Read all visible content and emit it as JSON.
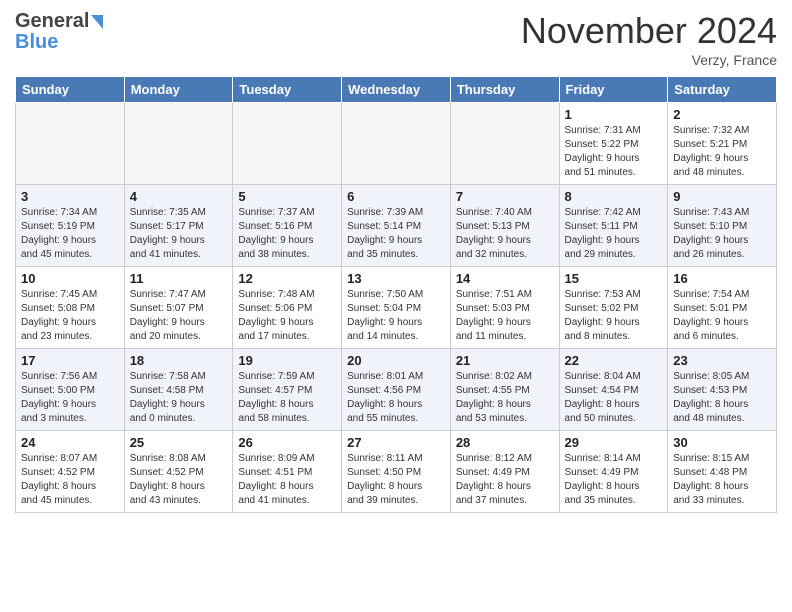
{
  "header": {
    "logo_general": "General",
    "logo_blue": "Blue",
    "title": "November 2024",
    "location": "Verzy, France"
  },
  "columns": [
    "Sunday",
    "Monday",
    "Tuesday",
    "Wednesday",
    "Thursday",
    "Friday",
    "Saturday"
  ],
  "weeks": [
    [
      {
        "day": "",
        "info": ""
      },
      {
        "day": "",
        "info": ""
      },
      {
        "day": "",
        "info": ""
      },
      {
        "day": "",
        "info": ""
      },
      {
        "day": "",
        "info": ""
      },
      {
        "day": "1",
        "info": "Sunrise: 7:31 AM\nSunset: 5:22 PM\nDaylight: 9 hours\nand 51 minutes."
      },
      {
        "day": "2",
        "info": "Sunrise: 7:32 AM\nSunset: 5:21 PM\nDaylight: 9 hours\nand 48 minutes."
      }
    ],
    [
      {
        "day": "3",
        "info": "Sunrise: 7:34 AM\nSunset: 5:19 PM\nDaylight: 9 hours\nand 45 minutes."
      },
      {
        "day": "4",
        "info": "Sunrise: 7:35 AM\nSunset: 5:17 PM\nDaylight: 9 hours\nand 41 minutes."
      },
      {
        "day": "5",
        "info": "Sunrise: 7:37 AM\nSunset: 5:16 PM\nDaylight: 9 hours\nand 38 minutes."
      },
      {
        "day": "6",
        "info": "Sunrise: 7:39 AM\nSunset: 5:14 PM\nDaylight: 9 hours\nand 35 minutes."
      },
      {
        "day": "7",
        "info": "Sunrise: 7:40 AM\nSunset: 5:13 PM\nDaylight: 9 hours\nand 32 minutes."
      },
      {
        "day": "8",
        "info": "Sunrise: 7:42 AM\nSunset: 5:11 PM\nDaylight: 9 hours\nand 29 minutes."
      },
      {
        "day": "9",
        "info": "Sunrise: 7:43 AM\nSunset: 5:10 PM\nDaylight: 9 hours\nand 26 minutes."
      }
    ],
    [
      {
        "day": "10",
        "info": "Sunrise: 7:45 AM\nSunset: 5:08 PM\nDaylight: 9 hours\nand 23 minutes."
      },
      {
        "day": "11",
        "info": "Sunrise: 7:47 AM\nSunset: 5:07 PM\nDaylight: 9 hours\nand 20 minutes."
      },
      {
        "day": "12",
        "info": "Sunrise: 7:48 AM\nSunset: 5:06 PM\nDaylight: 9 hours\nand 17 minutes."
      },
      {
        "day": "13",
        "info": "Sunrise: 7:50 AM\nSunset: 5:04 PM\nDaylight: 9 hours\nand 14 minutes."
      },
      {
        "day": "14",
        "info": "Sunrise: 7:51 AM\nSunset: 5:03 PM\nDaylight: 9 hours\nand 11 minutes."
      },
      {
        "day": "15",
        "info": "Sunrise: 7:53 AM\nSunset: 5:02 PM\nDaylight: 9 hours\nand 8 minutes."
      },
      {
        "day": "16",
        "info": "Sunrise: 7:54 AM\nSunset: 5:01 PM\nDaylight: 9 hours\nand 6 minutes."
      }
    ],
    [
      {
        "day": "17",
        "info": "Sunrise: 7:56 AM\nSunset: 5:00 PM\nDaylight: 9 hours\nand 3 minutes."
      },
      {
        "day": "18",
        "info": "Sunrise: 7:58 AM\nSunset: 4:58 PM\nDaylight: 9 hours\nand 0 minutes."
      },
      {
        "day": "19",
        "info": "Sunrise: 7:59 AM\nSunset: 4:57 PM\nDaylight: 8 hours\nand 58 minutes."
      },
      {
        "day": "20",
        "info": "Sunrise: 8:01 AM\nSunset: 4:56 PM\nDaylight: 8 hours\nand 55 minutes."
      },
      {
        "day": "21",
        "info": "Sunrise: 8:02 AM\nSunset: 4:55 PM\nDaylight: 8 hours\nand 53 minutes."
      },
      {
        "day": "22",
        "info": "Sunrise: 8:04 AM\nSunset: 4:54 PM\nDaylight: 8 hours\nand 50 minutes."
      },
      {
        "day": "23",
        "info": "Sunrise: 8:05 AM\nSunset: 4:53 PM\nDaylight: 8 hours\nand 48 minutes."
      }
    ],
    [
      {
        "day": "24",
        "info": "Sunrise: 8:07 AM\nSunset: 4:52 PM\nDaylight: 8 hours\nand 45 minutes."
      },
      {
        "day": "25",
        "info": "Sunrise: 8:08 AM\nSunset: 4:52 PM\nDaylight: 8 hours\nand 43 minutes."
      },
      {
        "day": "26",
        "info": "Sunrise: 8:09 AM\nSunset: 4:51 PM\nDaylight: 8 hours\nand 41 minutes."
      },
      {
        "day": "27",
        "info": "Sunrise: 8:11 AM\nSunset: 4:50 PM\nDaylight: 8 hours\nand 39 minutes."
      },
      {
        "day": "28",
        "info": "Sunrise: 8:12 AM\nSunset: 4:49 PM\nDaylight: 8 hours\nand 37 minutes."
      },
      {
        "day": "29",
        "info": "Sunrise: 8:14 AM\nSunset: 4:49 PM\nDaylight: 8 hours\nand 35 minutes."
      },
      {
        "day": "30",
        "info": "Sunrise: 8:15 AM\nSunset: 4:48 PM\nDaylight: 8 hours\nand 33 minutes."
      }
    ]
  ]
}
